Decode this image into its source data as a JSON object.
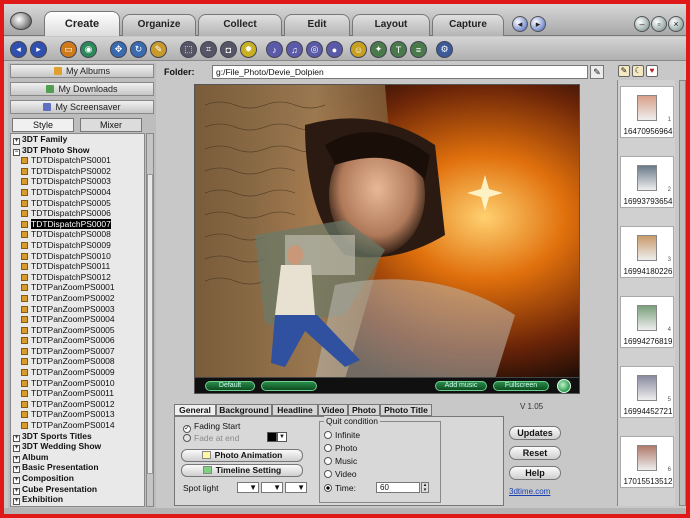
{
  "tabs": [
    "Create",
    "Organize",
    "Collect",
    "Edit",
    "Layout",
    "Capture"
  ],
  "nav": {
    "albums": "My Albums",
    "downloads": "My Downloads",
    "screensaver": "My Screensaver",
    "style_tab": "Style",
    "mixer_tab": "Mixer"
  },
  "tree": [
    {
      "label": "3DT Family",
      "level": 0,
      "bold": true
    },
    {
      "label": "3DT Photo Show",
      "level": 0,
      "bold": true
    },
    {
      "label": "TDTDispatchPS0001",
      "level": 1
    },
    {
      "label": "TDTDispatchPS0002",
      "level": 1
    },
    {
      "label": "TDTDispatchPS0003",
      "level": 1
    },
    {
      "label": "TDTDispatchPS0004",
      "level": 1
    },
    {
      "label": "TDTDispatchPS0005",
      "level": 1
    },
    {
      "label": "TDTDispatchPS0006",
      "level": 1
    },
    {
      "label": "TDTDispatchPS0007",
      "level": 1,
      "selected": true
    },
    {
      "label": "TDTDispatchPS0008",
      "level": 1
    },
    {
      "label": "TDTDispatchPS0009",
      "level": 1
    },
    {
      "label": "TDTDispatchPS0010",
      "level": 1
    },
    {
      "label": "TDTDispatchPS0011",
      "level": 1
    },
    {
      "label": "TDTDispatchPS0012",
      "level": 1
    },
    {
      "label": "TDTPanZoomPS0001",
      "level": 1
    },
    {
      "label": "TDTPanZoomPS0002",
      "level": 1
    },
    {
      "label": "TDTPanZoomPS0003",
      "level": 1
    },
    {
      "label": "TDTPanZoomPS0004",
      "level": 1
    },
    {
      "label": "TDTPanZoomPS0005",
      "level": 1
    },
    {
      "label": "TDTPanZoomPS0006",
      "level": 1
    },
    {
      "label": "TDTPanZoomPS0007",
      "level": 1
    },
    {
      "label": "TDTPanZoomPS0008",
      "level": 1
    },
    {
      "label": "TDTPanZoomPS0009",
      "level": 1
    },
    {
      "label": "TDTPanZoomPS0010",
      "level": 1
    },
    {
      "label": "TDTPanZoomPS0011",
      "level": 1
    },
    {
      "label": "TDTPanZoomPS0012",
      "level": 1
    },
    {
      "label": "TDTPanZoomPS0013",
      "level": 1
    },
    {
      "label": "TDTPanZoomPS0014",
      "level": 1
    },
    {
      "label": "3DT Sports Titles",
      "level": 0,
      "bold": true
    },
    {
      "label": "3DT Wedding Show",
      "level": 0,
      "bold": true
    },
    {
      "label": "Album",
      "level": 0,
      "bold": true
    },
    {
      "label": "Basic Presentation",
      "level": 0,
      "bold": true
    },
    {
      "label": "Composition",
      "level": 0,
      "bold": true
    },
    {
      "label": "Cube Presentation",
      "level": 0,
      "bold": true
    },
    {
      "label": "Exhibition",
      "level": 0,
      "bold": true
    }
  ],
  "folder": {
    "label": "Folder:",
    "path": "g:/File_Photo/Devie_Dolpien"
  },
  "preview": {
    "controls": [
      "Default",
      "Add music",
      "Fullscreen"
    ]
  },
  "version": "V 1.05",
  "panel_tabs": [
    "General",
    "Background",
    "Headline",
    "Video",
    "Photo",
    "Photo Title"
  ],
  "general": {
    "fading_start": "Fading Start",
    "fade_at_end": "Fade at end",
    "photo_animation": "Photo Animation",
    "timeline_setting": "Timeline Setting",
    "spot_light": "Spot light",
    "quit_condition": "Quit condition",
    "quit_options": [
      "Infinite",
      "Photo",
      "Music",
      "Video",
      "Time:"
    ],
    "time_value": "60"
  },
  "right_buttons": [
    "Updates",
    "Reset",
    "Help"
  ],
  "website": "3dtime.com",
  "thumbnails": [
    {
      "label": "16470956964",
      "index": "1"
    },
    {
      "label": "16993793654",
      "index": "2"
    },
    {
      "label": "16994180226",
      "index": "3"
    },
    {
      "label": "16994276819",
      "index": "4"
    },
    {
      "label": "16994452721",
      "index": "5"
    },
    {
      "label": "17015513512",
      "index": "6"
    }
  ],
  "colors": {
    "frame": "#e01818",
    "selection": "#000000",
    "link": "#1a3fb0"
  }
}
